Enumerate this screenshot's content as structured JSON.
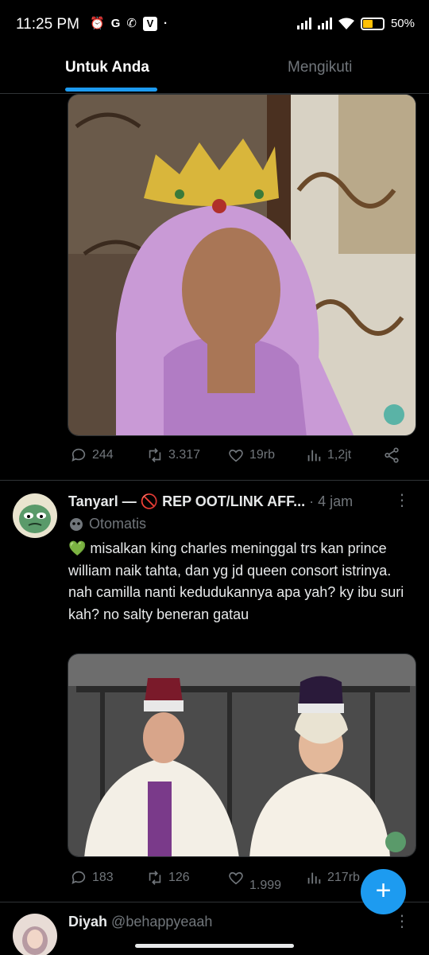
{
  "status_bar": {
    "time": "11:25 PM",
    "icons": [
      "alarm-icon",
      "google-icon",
      "phone-icon",
      "vpn-icon"
    ],
    "battery_percent": "50%",
    "battery_level": 0.5
  },
  "tabs": [
    {
      "label": "Untuk Anda",
      "active": true
    },
    {
      "label": "Mengikuti",
      "active": false
    }
  ],
  "tweet1": {
    "stats": {
      "replies": "244",
      "retweets": "3.317",
      "likes": "19rb",
      "views": "1,2jt"
    }
  },
  "tweet2": {
    "name": "Tanyarl — 🚫 REP OOT/LINK AFF...",
    "time": "· 4 jam",
    "automated_label": "Otomatis",
    "text": "💚 misalkan king charles meninggal trs kan prince william naik tahta, dan yg jd queen consort istrinya. nah camilla nanti kedudukannya apa yah? ky ibu suri kah? no salty beneran gatau",
    "stats": {
      "replies": "183",
      "retweets": "126",
      "likes": "1.999",
      "views": "217rb"
    }
  },
  "tweet3": {
    "name": "Diyah",
    "handle": "@behappyeaah"
  },
  "colors": {
    "accent": "#1d9bf0",
    "background": "#000000",
    "muted": "#71767b"
  }
}
